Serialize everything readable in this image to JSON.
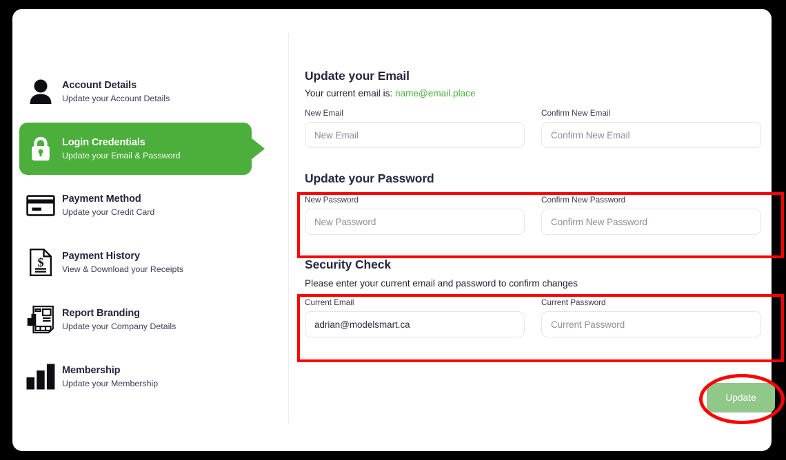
{
  "sidebar": {
    "items": [
      {
        "icon": "person-icon",
        "title": "Account Details",
        "subtitle": "Update your Account Details",
        "active": false
      },
      {
        "icon": "lock-icon",
        "title": "Login Credentials",
        "subtitle": "Update your Email & Password",
        "active": true
      },
      {
        "icon": "credit-card-icon",
        "title": "Payment Method",
        "subtitle": "Update your Credit Card",
        "active": false
      },
      {
        "icon": "receipt-icon",
        "title": "Payment History",
        "subtitle": "View & Download your Receipts",
        "active": false
      },
      {
        "icon": "report-icon",
        "title": "Report Branding",
        "subtitle": "Update your Company Details",
        "active": false
      },
      {
        "icon": "bar-chart-icon",
        "title": "Membership",
        "subtitle": "Update your Membership",
        "active": false
      }
    ]
  },
  "main": {
    "email_section": {
      "title": "Update your Email",
      "current_email_prefix": "Your current email is:",
      "current_email": "name@email.place",
      "new_email": {
        "label": "New Email",
        "placeholder": "New Email",
        "value": ""
      },
      "confirm_new_email": {
        "label": "Confirm New Email",
        "placeholder": "Confirm New Email",
        "value": ""
      }
    },
    "password_section": {
      "title": "Update your Password",
      "new_password": {
        "label": "New Password",
        "placeholder": "New Password",
        "value": ""
      },
      "confirm_new_password": {
        "label": "Confirm New Password",
        "placeholder": "Confirm New Password",
        "value": ""
      }
    },
    "security_section": {
      "title": "Security Check",
      "subtitle": "Please enter your current email and password to confirm changes",
      "current_email": {
        "label": "Current Email",
        "placeholder": "Current Email",
        "value": "adrian@modelsmart.ca"
      },
      "current_password": {
        "label": "Current Password",
        "placeholder": "Current Password",
        "value": ""
      }
    },
    "update_button_label": "Update"
  },
  "colors": {
    "brand_green": "#4caf3c",
    "button_green": "#8fc888",
    "annotation_red": "#ff0000",
    "heading_navy": "#262641"
  }
}
